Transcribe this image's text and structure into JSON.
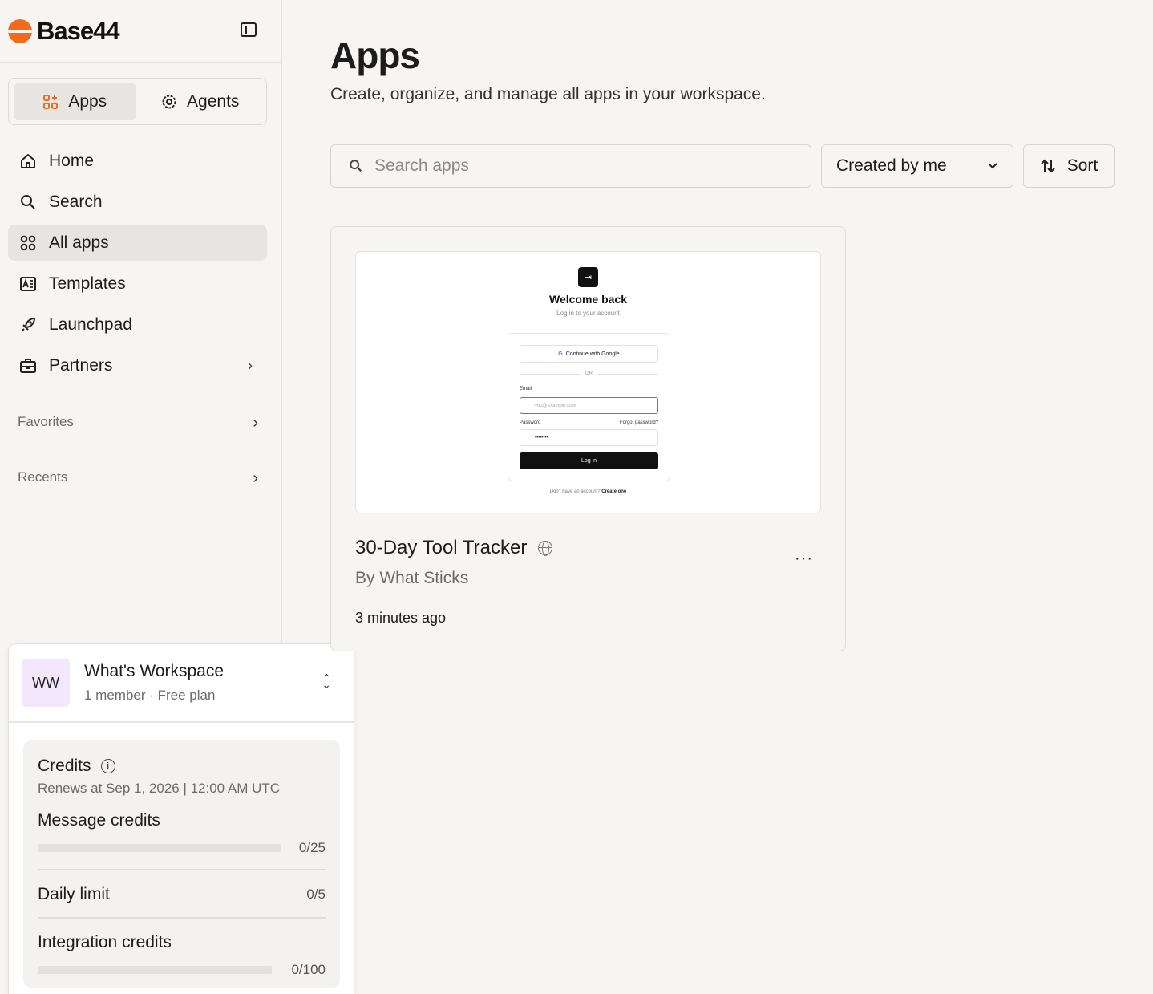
{
  "brand": {
    "name": "Base44",
    "accent": "#f26b1d"
  },
  "segments": [
    {
      "label": "Apps",
      "icon": "apps-grid-icon",
      "active": true
    },
    {
      "label": "Agents",
      "icon": "agent-gear-icon",
      "active": false
    }
  ],
  "nav": [
    {
      "label": "Home",
      "icon": "home-icon"
    },
    {
      "label": "Search",
      "icon": "search-icon"
    },
    {
      "label": "All apps",
      "icon": "grid-icon",
      "active": true
    },
    {
      "label": "Templates",
      "icon": "templates-icon"
    },
    {
      "label": "Launchpad",
      "icon": "rocket-icon"
    },
    {
      "label": "Partners",
      "icon": "briefcase-icon",
      "has_chevron": true
    }
  ],
  "sections": {
    "favorites": "Favorites",
    "recents": "Recents"
  },
  "workspace": {
    "initials": "WW",
    "name": "What's Workspace",
    "subtitle": "1 member · Free plan"
  },
  "credits": {
    "title": "Credits",
    "renews": "Renews at Sep 1, 2026 | 12:00 AM UTC",
    "message": {
      "label": "Message credits",
      "count": "0/25",
      "fraction": 0
    },
    "daily": {
      "label": "Daily limit",
      "count": "0/5"
    },
    "integration": {
      "label": "Integration credits",
      "count": "0/100",
      "fraction": 0
    }
  },
  "main": {
    "title": "Apps",
    "subtitle": "Create, organize, and manage all apps in your workspace.",
    "search_placeholder": "Search apps",
    "filter_label": "Created by me",
    "sort_label": "Sort"
  },
  "app_card": {
    "title": "30-Day Tool Tracker",
    "author": "By What Sticks",
    "time": "3 minutes ago",
    "preview": {
      "heading": "Welcome back",
      "subheading": "Log in to your account",
      "google_button": "Continue with Google",
      "divider": "OR",
      "email_label": "Email",
      "email_placeholder": "you@example.com",
      "password_label": "Password",
      "forgot": "Forgot password?",
      "password_value": "••••••••",
      "login_button": "Log in",
      "footer_text": "Don't have an account?",
      "footer_link": "Create one"
    }
  }
}
